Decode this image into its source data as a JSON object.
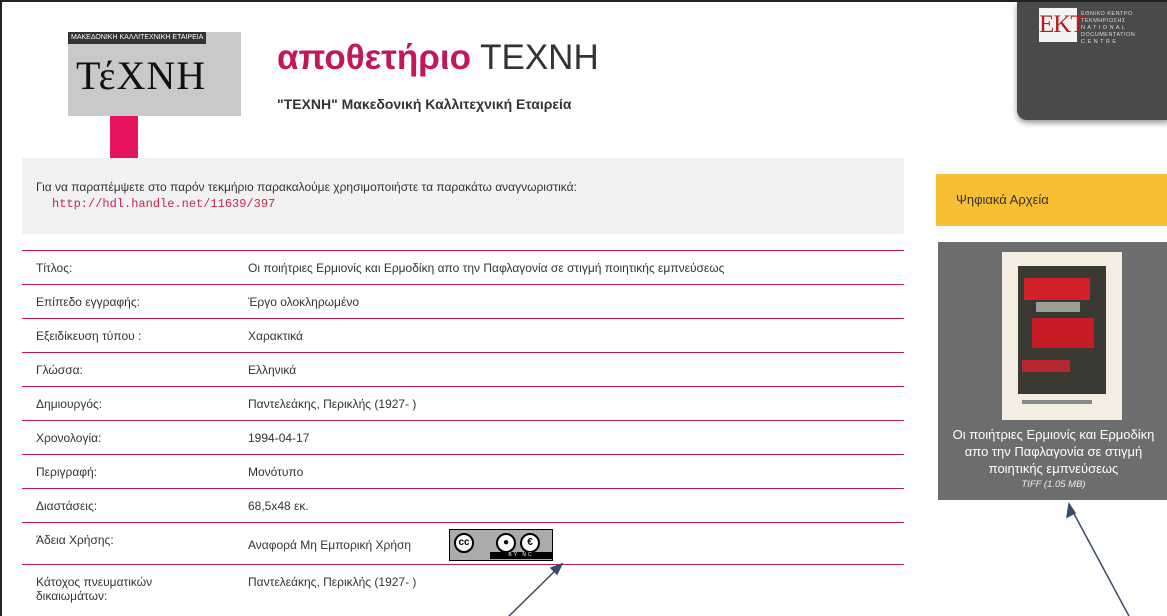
{
  "header": {
    "logo_small_text": "ΜΑΚΕΔΟΝΙΚΗ ΚΑΛΛΙΤΕΧΝΙΚΗ ΕΤΑΙΡΕΙΑ",
    "logo_word": "ΤέΧΝΗ",
    "title_part1": "αποθετήριο",
    "title_part2": "ΤΕΧΝΗ",
    "subtitle": "\"ΤΕΧΝΗ\" Μακεδονική Καλλιτεχνική Εταιρεία"
  },
  "ekt": {
    "mark": "EKT",
    "line1": "ΕΘΝΙΚΟ ΚΕΝΤΡΟ",
    "line2": "ΤΕΚΜΗΡΙΩΣΗΣ",
    "line3": "N A T I O N A L",
    "line4": "DOCUMENTATION",
    "line5": "C E N T R E"
  },
  "citation": {
    "text": "Για να παραπέμψετε στο παρόν τεκμήριο παρακαλούμε χρησιμοποιήστε τα παρακάτω αναγνωριστικά:",
    "link": "http://hdl.handle.net/11639/397"
  },
  "metadata": [
    {
      "label": "Τίτλος:",
      "value": "Οι ποιήτριες Ερμιονίς και Ερμοδίκη απο την Παφλαγονία σε στιγμή ποιητικής εμπνεύσεως"
    },
    {
      "label": "Επίπεδο εγγραφής:",
      "value": "Έργο ολοκληρωμένο"
    },
    {
      "label": "Εξειδίκευση τύπου :",
      "value": "Χαρακτικά"
    },
    {
      "label": "Γλώσσα:",
      "value": "Ελληνικά"
    },
    {
      "label": "Δημιουργός:",
      "value": "Παντελεάκης, Περικλής (1927- )"
    },
    {
      "label": "Χρονολογία:",
      "value": "1994-04-17"
    },
    {
      "label": "Περιγραφή:",
      "value": "Μονότυπο"
    },
    {
      "label": "Διαστάσεις:",
      "value": "68,5x48 εκ."
    },
    {
      "label": "Άδεια Χρήσης:",
      "value": "Αναφορά Μη Εμπορική Χρήση"
    },
    {
      "label": "Κάτοχος πνευματικών δικαιωμάτων:",
      "value": "Παντελεάκης, Περικλής (1927- )"
    }
  ],
  "license_badge": {
    "cc": "cc",
    "strip": "BY   NC"
  },
  "sidebar": {
    "archive_label": "Ψηφιακά Αρχεία",
    "caption_line1": "Οι ποιήτριες Ερμιονίς και Ερμοδίκη",
    "caption_line2": "απο την Παφλαγονία σε στιγμή",
    "caption_line3": "ποιητικής εμπνεύσεως",
    "file_size": "TIFF (1.05 MB)"
  },
  "colors": {
    "accent": "#c2185b",
    "archive_bar": "#f8be34",
    "card": "#6d6d6d"
  }
}
